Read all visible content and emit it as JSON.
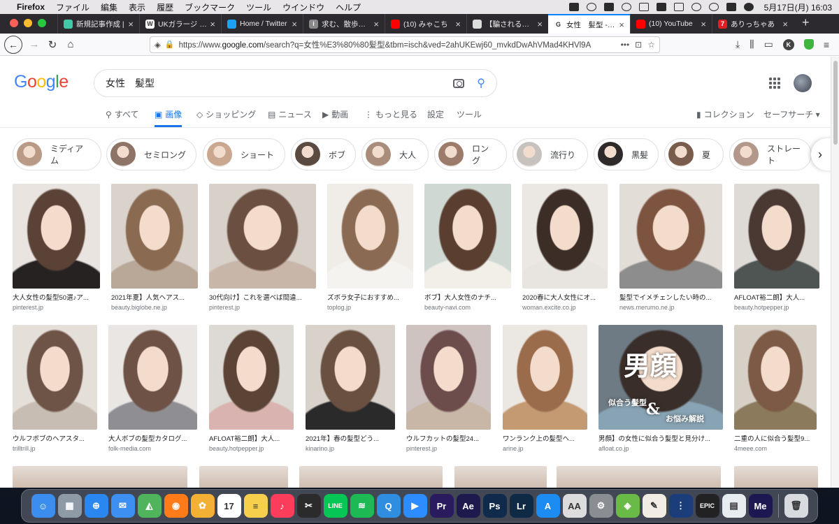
{
  "menubar": {
    "app": "Firefox",
    "items": [
      "ファイル",
      "編集",
      "表示",
      "履歴",
      "ブックマーク",
      "ツール",
      "ウインドウ",
      "ヘルプ"
    ],
    "clock": "5月17日(月)  16:03"
  },
  "tabs": [
    {
      "title": "新規記事作成 | ",
      "favicon_color": "#41c9a7",
      "favicon_letter": ""
    },
    {
      "title": "UKガラージ - W",
      "favicon_color": "#ffffff",
      "favicon_letter": "W"
    },
    {
      "title": "Home / Twitter",
      "favicon_color": "#1da1f2",
      "favicon_letter": ""
    },
    {
      "title": "求む、散歩の根",
      "favicon_color": "#8a8a8a",
      "favicon_letter": "i"
    },
    {
      "title": "(10) みゃこち",
      "favicon_color": "#ff0000",
      "favicon_letter": ""
    },
    {
      "title": "【騙される心理",
      "favicon_color": "#dddddd",
      "favicon_letter": ""
    },
    {
      "title": "女性　髪型 - Go",
      "favicon_color": "#ffffff",
      "favicon_letter": "G",
      "active": true
    },
    {
      "title": "(10) YouTube",
      "favicon_color": "#ff0000",
      "favicon_letter": ""
    },
    {
      "title": "ありっちゃあ",
      "favicon_color": "#e02020",
      "favicon_letter": "7"
    }
  ],
  "urlbar": {
    "prefix": "https://www.",
    "host": "google.com",
    "rest": "/search?q=女性%E3%80%80髪型&tbm=isch&ved=2ahUKEwj60_mvkdDwAhVMad4KHVl9A"
  },
  "search": {
    "logo": [
      "G",
      "o",
      "o",
      "g",
      "l",
      "e"
    ],
    "query": "女性　髪型"
  },
  "gtabs": [
    {
      "label": "すべて",
      "icon": "search-icon"
    },
    {
      "label": "画像",
      "icon": "image-icon",
      "active": true
    },
    {
      "label": "ショッピング",
      "icon": "tag-icon"
    },
    {
      "label": "ニュース",
      "icon": "news-icon"
    },
    {
      "label": "動画",
      "icon": "video-icon"
    },
    {
      "label": "もっと見る",
      "icon": "more-icon"
    },
    {
      "label": "設定",
      "icon": ""
    },
    {
      "label": "ツール",
      "icon": ""
    },
    {
      "label": "コレクション",
      "icon": "bookmark-icon"
    },
    {
      "label": "セーフサーチ ▾",
      "icon": ""
    }
  ],
  "chips": [
    {
      "label": "ミディアム",
      "tone": "#b89a86"
    },
    {
      "label": "セミロング",
      "tone": "#8d7466"
    },
    {
      "label": "ショート",
      "tone": "#c9a88f"
    },
    {
      "label": "ボブ",
      "tone": "#5a4a40"
    },
    {
      "label": "大人",
      "tone": "#a98c7a"
    },
    {
      "label": "ロング",
      "tone": "#9c7b6a"
    },
    {
      "label": "流行り",
      "tone": "#c7c2bd"
    },
    {
      "label": "黒髪",
      "tone": "#2e2a2a"
    },
    {
      "label": "夏",
      "tone": "#7a5c4c"
    },
    {
      "label": "ストレート",
      "tone": "#b3978a"
    }
  ],
  "results_row1": [
    {
      "title": "大人女性の髪型50選♪ア...",
      "source": "pinterest.jp",
      "bg": "#e9e4df",
      "hair": "#5b4236",
      "top": "#262222"
    },
    {
      "title": "2021年夏】人気ヘアス...",
      "source": "beauty.biglobe.ne.jp",
      "bg": "#d9d3cc",
      "hair": "#8b6a52",
      "top": "#b9a797"
    },
    {
      "title": "30代向け】これを選べば間違...",
      "source": "pinterest.jp",
      "bg": "#d8d1ca",
      "hair": "#6b5041",
      "top": "#c8b6a8"
    },
    {
      "title": "ズボラ女子におすすめ...",
      "source": "toplog.jp",
      "bg": "#f0ede8",
      "hair": "#8a6a52",
      "top": "#f5f3ef"
    },
    {
      "title": "ボブ】大人女性のナチ...",
      "source": "beauty-navi.com",
      "bg": "#cfd8d3",
      "hair": "#5a3f31",
      "top": "#f2eee8"
    },
    {
      "title": "2020春に大人女性にオ...",
      "source": "woman.excite.co.jp",
      "bg": "#ebe8e4",
      "hair": "#3c2d27",
      "top": "#e8e4df"
    },
    {
      "title": "髪型でイメチェンしたい時の...",
      "source": "news.merumo.ne.jp",
      "bg": "#e3ddd8",
      "hair": "#7c5440",
      "top": "#8d8d8d"
    },
    {
      "title": "AFLOAT裕二朗】大人...",
      "source": "beauty.hotpepper.jp",
      "bg": "#dedad6",
      "hair": "#4a3832",
      "top": "#4e5552"
    }
  ],
  "results_row2": [
    {
      "title": "ウルフボブのヘアスタ...",
      "source": "trilltrill.jp",
      "bg": "#e5dfda",
      "hair": "#6e5446",
      "top": "#c7bdb2"
    },
    {
      "title": "大人ボブの髪型カタログ...",
      "source": "folk-media.com",
      "bg": "#e9e6e3",
      "hair": "#6d5245",
      "top": "#8f8f93"
    },
    {
      "title": "AFLOAT裕二朗】大人...",
      "source": "beauty.hotpepper.jp",
      "bg": "#ddd9d4",
      "hair": "#5b4335",
      "top": "#d8b3b0"
    },
    {
      "title": "2021年】春の髪型どう...",
      "source": "kinarino.jp",
      "bg": "#d8d2cb",
      "hair": "#6a5040",
      "top": "#2a2a2a"
    },
    {
      "title": "ウルフカットの髪型24...",
      "source": "pinterest.jp",
      "bg": "#cfc3c2",
      "hair": "#6d4c4c",
      "top": "#c8b6a6"
    },
    {
      "title": "ワンランク上の髪型ヘ...",
      "source": "arine.jp",
      "bg": "#ebe7e2",
      "hair": "#9a6c4c",
      "top": "#c49a72"
    },
    {
      "title": "男顔】の女性に似合う髪型と見分け...",
      "source": "afloat.co.jp",
      "bg": "#6e7a84",
      "hair": "#3a2e2a",
      "top": "#88a3b3",
      "overlay_big": "男顔",
      "overlay_small": "似合う髪型",
      "overlay_amp": "&",
      "overlay_sub": "お悩み解説"
    },
    {
      "title": "二重の人に似合う髪型9...",
      "source": "4meee.com",
      "bg": "#d7d0c7",
      "hair": "#7d5a46",
      "top": "#8b7a5c"
    }
  ],
  "dock": [
    {
      "name": "finder",
      "color": "#3b8df0",
      "glyph": "☺"
    },
    {
      "name": "launchpad",
      "color": "#8e9aa6",
      "glyph": "▦"
    },
    {
      "name": "safari",
      "color": "#2a87f0",
      "glyph": "⊕"
    },
    {
      "name": "mail",
      "color": "#3d8ff2",
      "glyph": "✉"
    },
    {
      "name": "maps",
      "color": "#4fb45c",
      "glyph": "◭"
    },
    {
      "name": "firefox",
      "color": "#ff7a18",
      "glyph": "◉"
    },
    {
      "name": "photos",
      "color": "#f2b134",
      "glyph": "✿"
    },
    {
      "name": "calendar",
      "color": "#ffffff",
      "glyph": "17"
    },
    {
      "name": "notes",
      "color": "#f6d04d",
      "glyph": "≡"
    },
    {
      "name": "music",
      "color": "#fb3c5a",
      "glyph": "♪"
    },
    {
      "name": "finalcut",
      "color": "#2b2b2b",
      "glyph": "✂"
    },
    {
      "name": "line",
      "color": "#06c755",
      "glyph": "LINE"
    },
    {
      "name": "spotify",
      "color": "#1db954",
      "glyph": "≋"
    },
    {
      "name": "quicktime",
      "color": "#2f8ee0",
      "glyph": "Q"
    },
    {
      "name": "zoom",
      "color": "#2d8cff",
      "glyph": "▶"
    },
    {
      "name": "premiere",
      "color": "#2a1a5e",
      "glyph": "Pr"
    },
    {
      "name": "aftereffects",
      "color": "#1f1a4d",
      "glyph": "Ae"
    },
    {
      "name": "photoshop",
      "color": "#0f2a4a",
      "glyph": "Ps"
    },
    {
      "name": "lightroom",
      "color": "#0e2a45",
      "glyph": "Lr"
    },
    {
      "name": "appstore",
      "color": "#1c8cf2",
      "glyph": "A"
    },
    {
      "name": "fontbook",
      "color": "#dcdcdc",
      "glyph": "AA"
    },
    {
      "name": "settings",
      "color": "#8a8e93",
      "glyph": "⚙"
    },
    {
      "name": "android",
      "color": "#6aba48",
      "glyph": "◈"
    },
    {
      "name": "scrivener",
      "color": "#f1ede4",
      "glyph": "✎"
    },
    {
      "name": "soundwave",
      "color": "#1b3d7a",
      "glyph": "⋮"
    },
    {
      "name": "epicgames",
      "color": "#222222",
      "glyph": "EPIC"
    },
    {
      "name": "preview",
      "color": "#e7ecf1",
      "glyph": "▤"
    },
    {
      "name": "mediaencoder",
      "color": "#1d1852",
      "glyph": "Me"
    },
    {
      "name": "trash",
      "color": "#d7dbe0",
      "glyph": "🗑"
    }
  ]
}
